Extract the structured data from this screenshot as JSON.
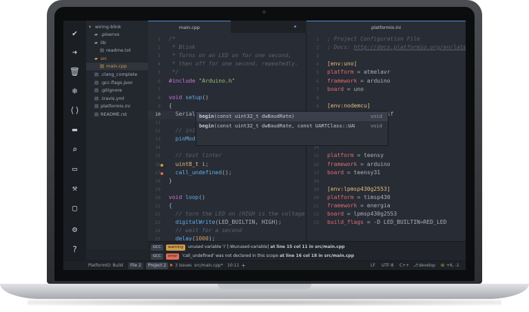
{
  "rail_icons": [
    "check-icon",
    "arrow-right-icon",
    "trash-icon",
    "snowflake-icon",
    "code-icon",
    "folder-icon",
    "search-icon",
    "terminal-icon",
    "wrench-icon",
    "window-icon",
    "gear-icon",
    "help-icon"
  ],
  "tree": {
    "root": "wiring-blink",
    "items": [
      {
        "name": ".pioenvs",
        "kind": "folder",
        "depth": 1
      },
      {
        "name": "lib",
        "kind": "folder-open",
        "depth": 1
      },
      {
        "name": "readme.txt",
        "kind": "file",
        "depth": 2
      },
      {
        "name": "src",
        "kind": "folder-open",
        "depth": 1,
        "accent": true
      },
      {
        "name": "main.cpp",
        "kind": "file",
        "depth": 2,
        "accent": true,
        "selected": true
      },
      {
        "name": ".clang_complete",
        "kind": "file",
        "depth": 1
      },
      {
        "name": ".gcc-flags.json",
        "kind": "file",
        "depth": 1
      },
      {
        "name": ".gitignore",
        "kind": "file",
        "depth": 1
      },
      {
        "name": ".travis.yml",
        "kind": "file",
        "depth": 1
      },
      {
        "name": "platformio.ini",
        "kind": "file",
        "depth": 1
      },
      {
        "name": "README.rst",
        "kind": "file",
        "depth": 1
      }
    ]
  },
  "tabs": {
    "left": "main.cpp",
    "right": "platformio.ini"
  },
  "editor_left": {
    "current_line": 10,
    "lines": [
      {
        "n": "1",
        "t": [
          [
            "com",
            "/*"
          ]
        ]
      },
      {
        "n": "2",
        "t": [
          [
            "com",
            " * Blink"
          ]
        ]
      },
      {
        "n": "3",
        "t": [
          [
            "com",
            " * Turns on an LED on for one second,"
          ]
        ]
      },
      {
        "n": "4",
        "t": [
          [
            "com",
            " * then off for one second, repeatedly."
          ]
        ]
      },
      {
        "n": "5",
        "t": [
          [
            "com",
            " */"
          ]
        ]
      },
      {
        "n": "6",
        "t": [
          [
            "kw",
            "#include "
          ],
          [
            "str",
            "\"Arduino.h\""
          ]
        ]
      },
      {
        "n": "7",
        "t": []
      },
      {
        "n": "8",
        "t": [
          [
            "kw",
            "void "
          ],
          [
            "fn",
            "setup"
          ],
          [
            "pun",
            "()"
          ]
        ]
      },
      {
        "n": "9",
        "t": [
          [
            "pun",
            "{"
          ]
        ]
      },
      {
        "n": "10",
        "t": [
          [
            "pun",
            "  Serial.b"
          ]
        ]
      },
      {
        "n": "11",
        "t": []
      },
      {
        "n": "12",
        "t": [
          [
            "com",
            "  // init"
          ]
        ]
      },
      {
        "n": "13",
        "t": [
          [
            "fn",
            "  pinMode"
          ]
        ]
      },
      {
        "n": "14",
        "t": []
      },
      {
        "n": "15",
        "t": [
          [
            "com",
            "  // test linter"
          ]
        ]
      },
      {
        "n": "16",
        "t": [
          [
            "typ",
            "  uint8_t "
          ],
          [
            "pun",
            "i;"
          ]
        ]
      },
      {
        "n": "17",
        "t": [
          [
            "fn",
            "  call_undefined"
          ],
          [
            "pun",
            "();"
          ]
        ]
      },
      {
        "n": "18",
        "t": [
          [
            "pun",
            "}"
          ]
        ]
      },
      {
        "n": "19",
        "t": []
      },
      {
        "n": "20",
        "t": [
          [
            "kw",
            "void "
          ],
          [
            "fn",
            "loop"
          ],
          [
            "pun",
            "()"
          ]
        ]
      },
      {
        "n": "21",
        "t": [
          [
            "pun",
            "{"
          ]
        ]
      },
      {
        "n": "22",
        "t": [
          [
            "com",
            "  // turn the LED on (HIGH is the voltage l"
          ]
        ]
      },
      {
        "n": "23",
        "t": [
          [
            "fn",
            "  digitalWrite"
          ],
          [
            "pun",
            "(LED_BUILTIN, HIGH);"
          ]
        ]
      },
      {
        "n": "24",
        "t": [
          [
            "com",
            "  // wait for a second"
          ]
        ]
      },
      {
        "n": "25",
        "t": [
          [
            "fn",
            "  delay"
          ],
          [
            "pun",
            "("
          ],
          [
            "num",
            "1000"
          ],
          [
            "pun",
            ");"
          ]
        ]
      },
      {
        "n": "26",
        "t": [
          [
            "com",
            "  // turn the LED off by making the voltage"
          ]
        ]
      },
      {
        "n": "27",
        "t": [
          [
            "fn",
            "  digitalWrite"
          ],
          [
            "pun",
            "(LED_BUILTIN, LOW);"
          ]
        ]
      }
    ]
  },
  "editor_right": {
    "lines": [
      {
        "n": "1",
        "t": [
          [
            "com",
            "; Project Configuration File"
          ]
        ]
      },
      {
        "n": "2",
        "t": [
          [
            "com",
            "; Docs: "
          ],
          [
            "url",
            "http://docs.platformio.org/en/lates"
          ]
        ]
      },
      {
        "n": "3",
        "t": []
      },
      {
        "n": "4",
        "t": [
          [
            "typ",
            "[env:uno]"
          ]
        ]
      },
      {
        "n": "5",
        "t": [
          [
            "key",
            "platform "
          ],
          [
            "pun",
            "= atmelavr"
          ]
        ]
      },
      {
        "n": "6",
        "t": [
          [
            "key",
            "framework "
          ],
          [
            "pun",
            "= arduino"
          ]
        ]
      },
      {
        "n": "7",
        "t": [
          [
            "key",
            "board "
          ],
          [
            "pun",
            "= uno"
          ]
        ]
      },
      {
        "n": "8",
        "t": []
      },
      {
        "n": "9",
        "t": [
          [
            "typ",
            "[env:nodemcu]"
          ]
        ]
      },
      {
        "n": "10",
        "t": [
          [
            "key",
            "platform "
          ],
          [
            "pun",
            "= espressif"
          ]
        ]
      },
      {
        "n": "11",
        "t": []
      },
      {
        "n": "12",
        "t": []
      },
      {
        "n": "13",
        "t": []
      },
      {
        "n": "14",
        "t": []
      },
      {
        "n": "15",
        "t": [
          [
            "key",
            "platform "
          ],
          [
            "pun",
            "= teensy"
          ]
        ]
      },
      {
        "n": "16",
        "t": [
          [
            "key",
            "framework "
          ],
          [
            "pun",
            "= arduino"
          ]
        ]
      },
      {
        "n": "17",
        "t": [
          [
            "key",
            "board "
          ],
          [
            "pun",
            "= teensy31"
          ]
        ]
      },
      {
        "n": "18",
        "t": []
      },
      {
        "n": "19",
        "t": [
          [
            "typ",
            "[env:lpmsp430g2553]"
          ]
        ]
      },
      {
        "n": "20",
        "t": [
          [
            "key",
            "platform "
          ],
          [
            "pun",
            "= timsp430"
          ]
        ]
      },
      {
        "n": "21",
        "t": [
          [
            "key",
            "framework "
          ],
          [
            "pun",
            "= energia"
          ]
        ]
      },
      {
        "n": "22",
        "t": [
          [
            "key",
            "board "
          ],
          [
            "pun",
            "= lpmsp430g2553"
          ]
        ]
      },
      {
        "n": "23",
        "t": [
          [
            "key",
            "build_flags "
          ],
          [
            "pun",
            "= -D LED_BUILTIN=RED_LED"
          ]
        ]
      }
    ]
  },
  "autocomplete": {
    "items": [
      {
        "text_bold": "begin",
        "text_rest": "(const uint32_t dwBaudRate)",
        "type": "void"
      },
      {
        "text_bold": "begin",
        "text_rest": "(const uint32_t dwBaudRate, const UARTClass::UARTMode…",
        "type": "void"
      }
    ]
  },
  "lint": {
    "warning": {
      "src": "GCC",
      "level": "warning",
      "msg": "unused variable 'i' [-Wunused-variable]",
      "loc": "at line 15 col 11 in src/main.cpp"
    },
    "error": {
      "src": "GCC",
      "level": "error",
      "msg": "'call_undefined' was not declared in this scope",
      "loc": "at line 16 col 18 in src/main.cpp"
    }
  },
  "status": {
    "build": "PlatformIO: Build",
    "file_tab": "File 2",
    "project_tab": "Project 2",
    "issues": "3 issues",
    "path": "src/main.cpp*",
    "position": "10:11",
    "plus": "+",
    "line_ending": "LF",
    "encoding": "UTF-8",
    "grammar": "C++",
    "branch": "develop",
    "diff": "+6, -1"
  },
  "colors": {
    "accent": "#5a8fd8",
    "warning": "#d19a4a",
    "error": "#e06c55",
    "folder_accent": "#d19a4a"
  }
}
